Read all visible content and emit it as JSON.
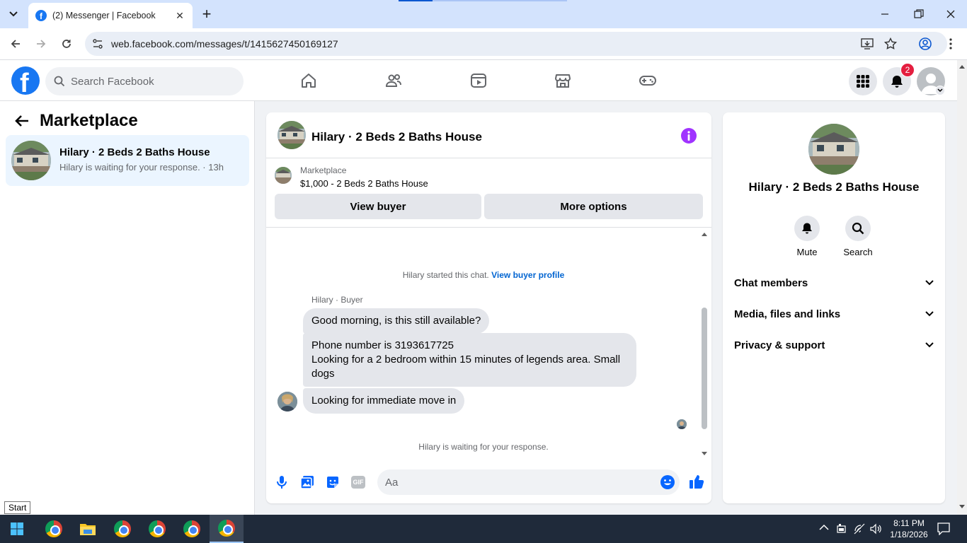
{
  "browser": {
    "tab_title": "(2) Messenger | Facebook",
    "url": "web.facebook.com/messages/t/1415627450169127"
  },
  "fb_header": {
    "search_placeholder": "Search Facebook",
    "notification_count": "2"
  },
  "left_panel": {
    "title": "Marketplace",
    "threads": [
      {
        "name": "Hilary · 2 Beds 2 Baths House",
        "preview": "Hilary is waiting for your response. · 13h"
      }
    ]
  },
  "chat": {
    "title": "Hilary · 2 Beds 2 Baths House",
    "marketplace_label": "Marketplace",
    "listing": "$1,000 - 2 Beds 2 Baths House",
    "view_buyer_label": "View buyer",
    "more_options_label": "More options",
    "started_text": "Hilary started this chat.",
    "view_profile_link": "View buyer profile",
    "sender_label": "Hilary · Buyer",
    "messages": [
      "Good morning, is this still available?",
      "Phone number is 3193617725\nLooking for a 2 bedroom within 15 minutes of legends area. Small dogs",
      "Looking for immediate move in"
    ],
    "waiting_text": "Hilary is waiting for your response.",
    "composer_placeholder": "Aa"
  },
  "right_panel": {
    "name": "Hilary · 2 Beds 2 Baths House",
    "mute_label": "Mute",
    "search_label": "Search",
    "sections": [
      "Chat members",
      "Media, files and links",
      "Privacy & support"
    ]
  },
  "taskbar": {
    "time": "8:11 PM",
    "date": "1/18/2026",
    "start_tooltip": "Start"
  },
  "colors": {
    "fb_blue": "#1877f2",
    "info_purple": "#a033ff",
    "thread_selected": "#ebf5ff",
    "badge_red": "#e41e3f"
  }
}
